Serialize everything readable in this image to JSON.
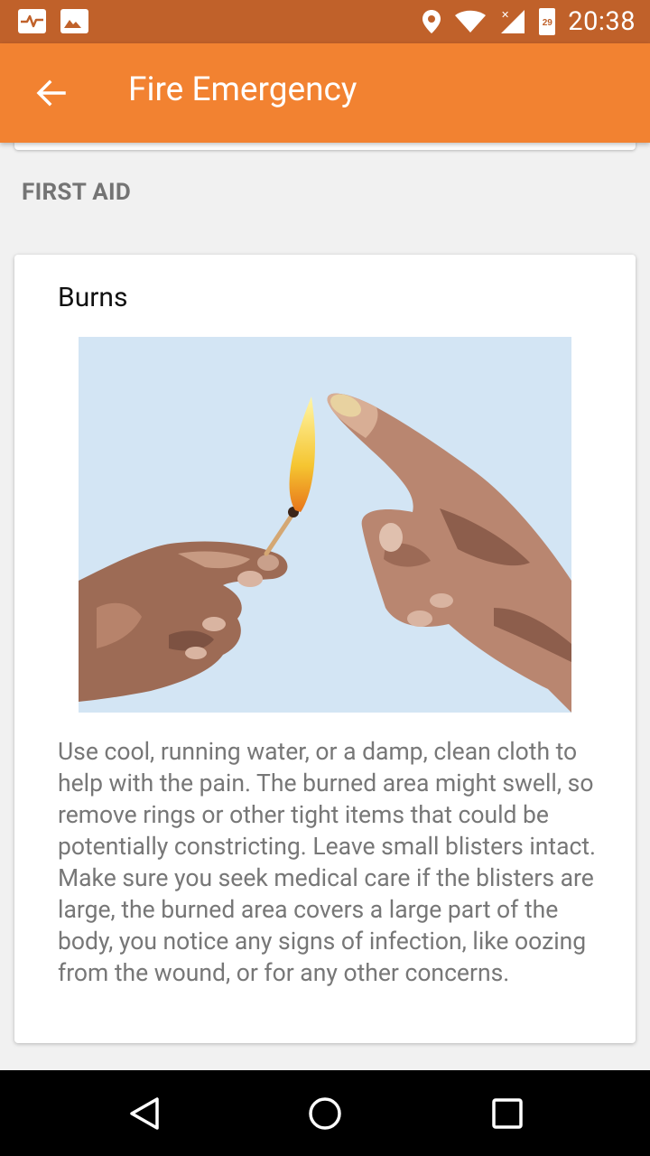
{
  "status_bar": {
    "time": "20:38",
    "battery_level": "29",
    "icons": [
      "activity-monitor-icon",
      "image-icon",
      "location-icon",
      "wifi-icon",
      "cell-signal-icon",
      "battery-icon"
    ]
  },
  "app_bar": {
    "title": "Fire Emergency",
    "back_icon": "arrow-left-icon",
    "color": "#f28231"
  },
  "section": {
    "header": "FIRST AID"
  },
  "card": {
    "title": "Burns",
    "image": "illustration of hand holding a lit match near another hand's fingertip",
    "body": "Use cool, running water, or a damp, clean cloth to help with the pain. The burned area might swell, so remove rings or other tight items that could be potentially constricting. Leave small blisters intact. Make sure you seek medical care if the blisters are large, the burned area covers a large part of the body, you notice any signs of infection, like oozing from the wound, or for any other concerns."
  },
  "nav_bar": {
    "buttons": [
      "back-triangle-icon",
      "home-circle-icon",
      "recents-square-icon"
    ]
  }
}
